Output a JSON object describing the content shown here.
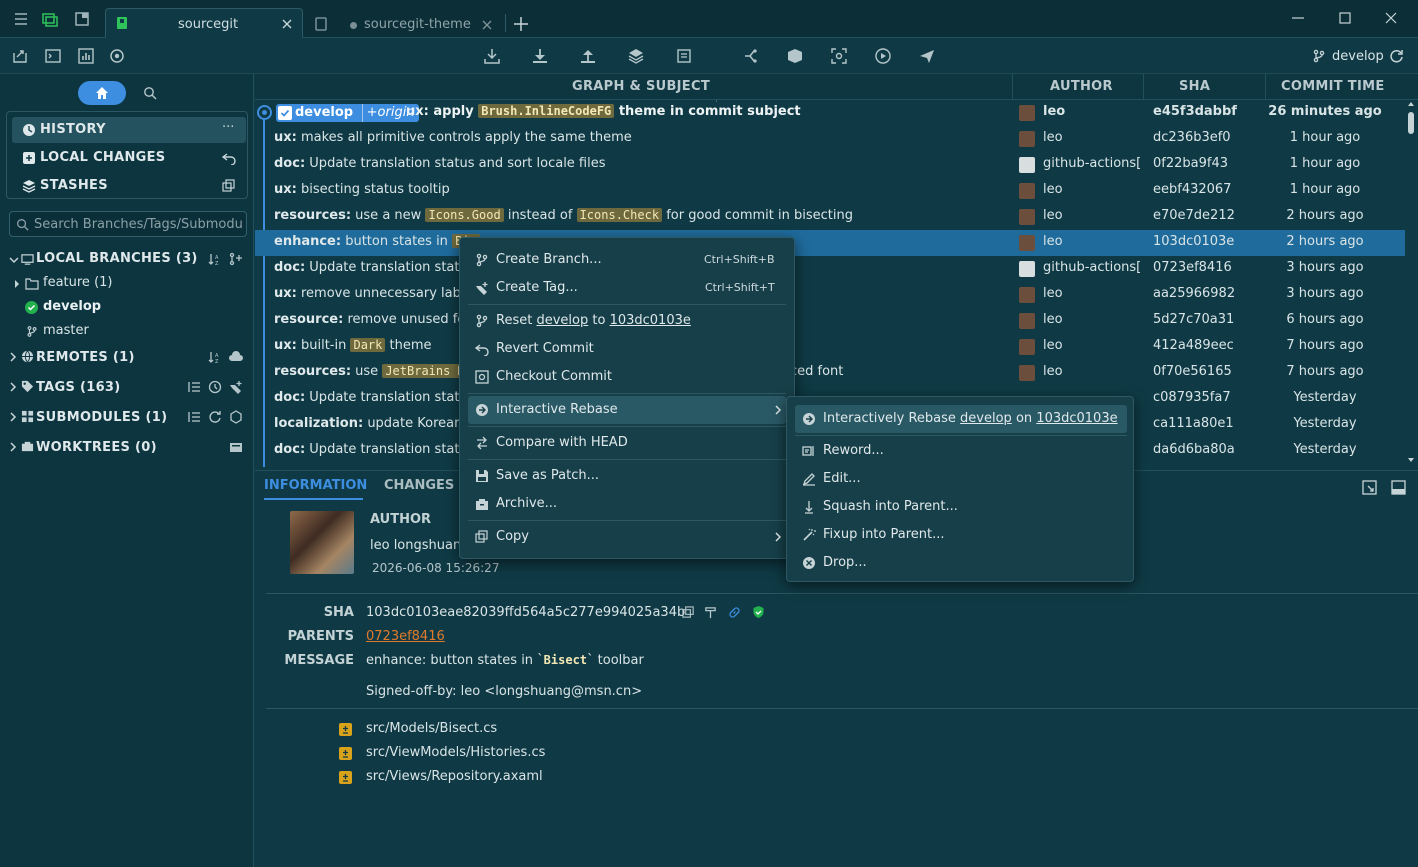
{
  "tabs": [
    {
      "title": "sourcegit",
      "active": true
    },
    {
      "title": "sourcegit-theme",
      "active": false
    }
  ],
  "branch_indicator": "develop",
  "sidebar": {
    "nav": [
      {
        "label": "HISTORY",
        "selected": true
      },
      {
        "label": "LOCAL CHANGES"
      },
      {
        "label": "STASHES"
      }
    ],
    "search_placeholder": "Search Branches/Tags/Submodules",
    "local_branches": "LOCAL BRANCHES (3)",
    "feature": "feature (1)",
    "develop": "develop",
    "master": "master",
    "remotes": "REMOTES (1)",
    "tags": "TAGS (163)",
    "submodules": "SUBMODULES (1)",
    "worktrees": "WORKTREES (0)"
  },
  "columns": {
    "subject": "GRAPH & SUBJECT",
    "author": "AUTHOR",
    "sha": "SHA",
    "time": "COMMIT TIME"
  },
  "commits": [
    {
      "badge_branch": "develop",
      "badge_remote": "+origin",
      "scope": "ux:",
      "text1": "apply",
      "code": "Brush.InlineCodeFG",
      "text2": "theme in commit subject",
      "author": "leo",
      "sha": "e45f3dabbf",
      "time": "26 minutes ago"
    },
    {
      "scope": "ux:",
      "text1": "makes all primitive controls apply the same theme",
      "author": "leo",
      "sha": "dc236b3ef0",
      "time": "1 hour ago"
    },
    {
      "scope": "doc:",
      "text1": "Update translation status and sort locale files",
      "author": "github-actions[",
      "sha": "0f22ba9f43",
      "time": "1 hour ago"
    },
    {
      "scope": "ux:",
      "text1": "bisecting status tooltip",
      "author": "leo",
      "sha": "eebf432067",
      "time": "1 hour ago"
    },
    {
      "scope": "resources:",
      "text1": "use a new",
      "code": "Icons.Good",
      "text2": "instead of",
      "code2": "Icons.Check",
      "text3": "for good commit in bisecting",
      "author": "leo",
      "sha": "e70e7de212",
      "time": "2 hours ago"
    },
    {
      "scope": "enhance:",
      "text1": "button states in",
      "code": "Bis",
      "author": "leo",
      "sha": "103dc0103e",
      "time": "2 hours ago"
    },
    {
      "scope": "doc:",
      "text1": "Update translation status",
      "author": "github-actions[",
      "sha": "0723ef8416",
      "time": "3 hours ago"
    },
    {
      "scope": "ux:",
      "text1": "remove unnecessary label",
      "author": "leo",
      "sha": "aa25966982",
      "time": "3 hours ago"
    },
    {
      "scope": "resource:",
      "text1": "remove unused font",
      "author": "leo",
      "sha": "5d27c70a31",
      "time": "6 hours ago"
    },
    {
      "scope": "ux:",
      "text1": "built-in",
      "code": "Dark",
      "text2": "theme",
      "author": "leo",
      "sha": "412a489eec",
      "time": "7 hours ago"
    },
    {
      "scope": "resources:",
      "text1": "use",
      "code": "JetBrains Mo",
      "text_tail": "ced font",
      "author": "leo",
      "sha": "0f70e56165",
      "time": "7 hours ago"
    },
    {
      "scope": "doc:",
      "text1": "Update translation status",
      "author": "",
      "sha": "c087935fa7",
      "time": "Yesterday"
    },
    {
      "scope": "localization:",
      "text1": "update Korean tr",
      "author": "",
      "sha": "ca111a80e1",
      "time": "Yesterday"
    },
    {
      "scope": "doc:",
      "text1": "Update translation status",
      "author": "",
      "sha": "da6d6ba80a",
      "time": "Yesterday"
    }
  ],
  "details": {
    "tabs": [
      "INFORMATION",
      "CHANGES"
    ],
    "author_label": "AUTHOR",
    "author_name": "leo longshuang",
    "author_date": "2026-06-08 15:26:27",
    "sha_label": "SHA",
    "sha_value": "103dc0103eae82039ffd564a5c277e994025a34b",
    "parents_label": "PARENTS",
    "parents_value": "0723ef8416",
    "message_label": "MESSAGE",
    "message_pre": "enhance: button states in `",
    "message_code": "Bisect",
    "message_post": "` toolbar",
    "signoff": "Signed-off-by: leo <longshuang@msn.cn>",
    "files": [
      "src/Models/Bisect.cs",
      "src/ViewModels/Histories.cs",
      "src/Views/Repository.axaml"
    ]
  },
  "context_menu": {
    "create_branch": "Create Branch...",
    "create_branch_key": "Ctrl+Shift+B",
    "create_tag": "Create Tag...",
    "create_tag_key": "Ctrl+Shift+T",
    "reset_pre": "Reset",
    "reset_branch": "develop",
    "reset_mid": "to",
    "reset_sha": "103dc0103e",
    "revert": "Revert Commit",
    "checkout": "Checkout Commit",
    "interactive_rebase": "Interactive Rebase",
    "compare_head": "Compare with HEAD",
    "save_patch": "Save as Patch...",
    "archive": "Archive...",
    "copy": "Copy"
  },
  "submenu": {
    "rebase_pre": "Interactively Rebase",
    "rebase_branch": "develop",
    "rebase_mid": "on",
    "rebase_sha": "103dc0103e",
    "reword": "Reword...",
    "edit": "Edit...",
    "squash": "Squash into Parent...",
    "fixup": "Fixup into Parent...",
    "drop": "Drop..."
  },
  "colors": {
    "accent": "#3d8ee0",
    "selected_row": "#1f6b9c",
    "code_bg": "#6f6a3e",
    "link": "#e07a2c",
    "green": "#22b14c"
  }
}
